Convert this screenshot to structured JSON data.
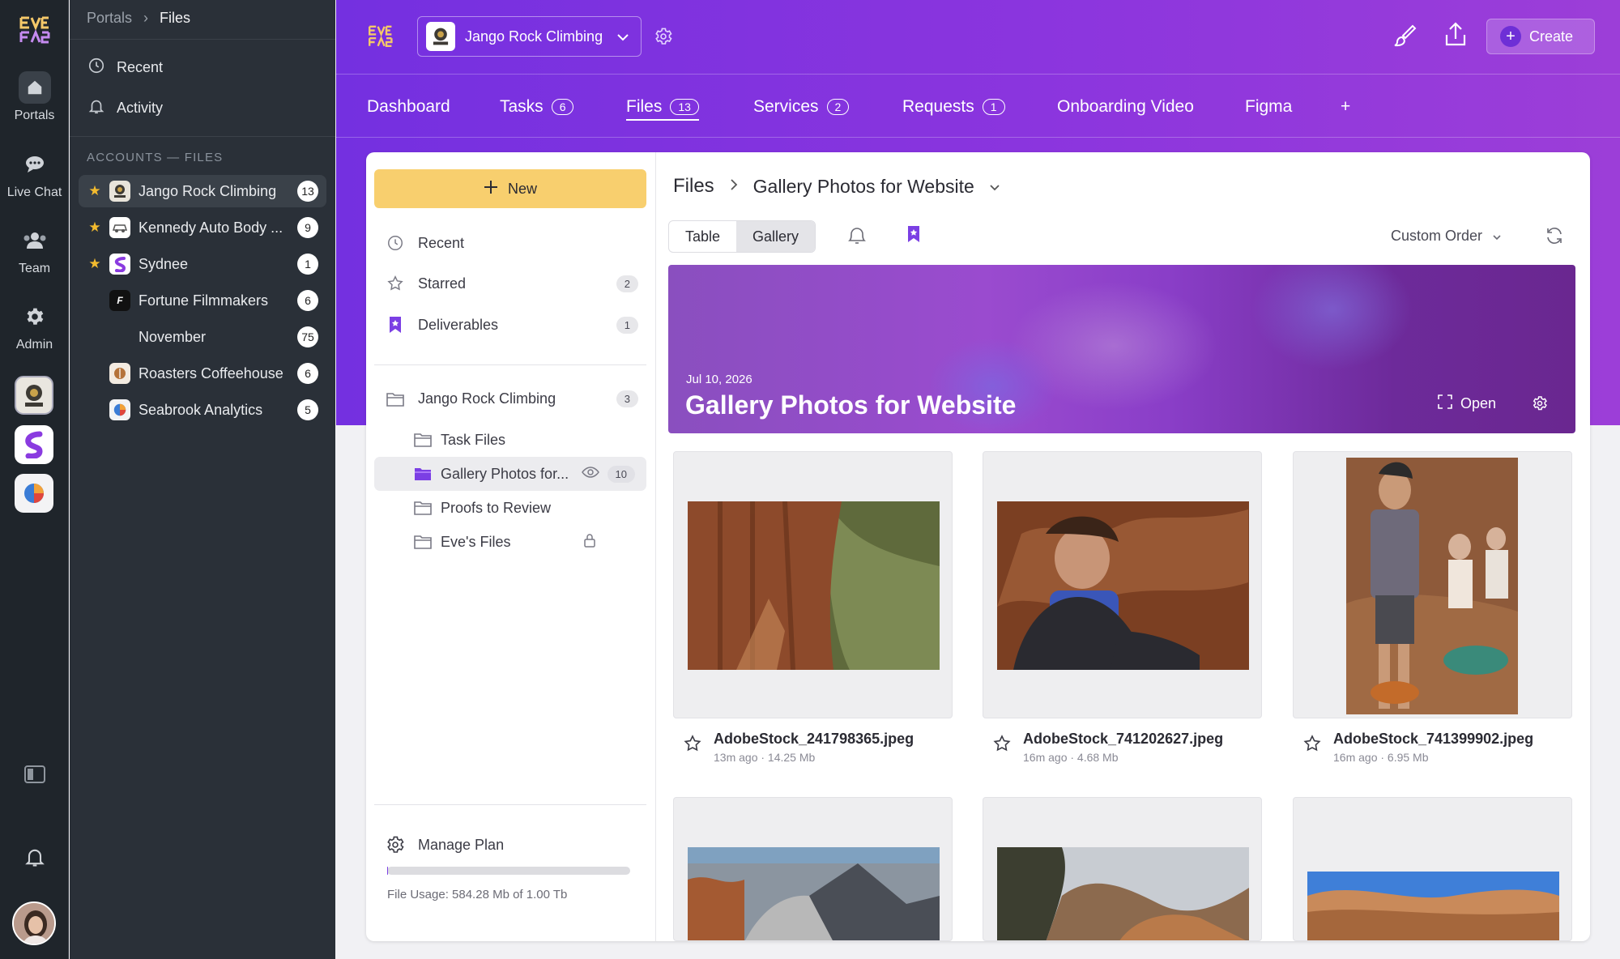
{
  "rail": {
    "items": [
      {
        "label": "Portals",
        "icon": "home-icon"
      },
      {
        "label": "Live Chat",
        "icon": "chat-icon"
      },
      {
        "label": "Team",
        "icon": "team-icon"
      },
      {
        "label": "Admin",
        "icon": "gear-icon"
      }
    ]
  },
  "nav": {
    "breadcrumb": [
      "Portals",
      "Files"
    ],
    "recent": "Recent",
    "activity": "Activity",
    "section_heading": "ACCOUNTS — FILES",
    "accounts": [
      {
        "name": "Jango Rock Climbing",
        "count": "13",
        "starred": true
      },
      {
        "name": "Kennedy Auto Body ...",
        "count": "9",
        "starred": true
      },
      {
        "name": "Sydnee",
        "count": "1",
        "starred": true
      },
      {
        "name": "Fortune Filmmakers",
        "count": "6",
        "starred": false
      },
      {
        "name": "November",
        "count": "75",
        "starred": false
      },
      {
        "name": "Roasters Coffeehouse",
        "count": "6",
        "starred": false
      },
      {
        "name": "Seabrook Analytics",
        "count": "5",
        "starred": false
      }
    ]
  },
  "header": {
    "workspace": "Jango Rock Climbing",
    "create_label": "Create",
    "tabs": [
      {
        "label": "Dashboard",
        "badge": ""
      },
      {
        "label": "Tasks",
        "badge": "6"
      },
      {
        "label": "Files",
        "badge": "13"
      },
      {
        "label": "Services",
        "badge": "2"
      },
      {
        "label": "Requests",
        "badge": "1"
      },
      {
        "label": "Onboarding Video",
        "badge": ""
      },
      {
        "label": "Figma",
        "badge": ""
      },
      {
        "label": "+",
        "badge": ""
      }
    ]
  },
  "files_nav": {
    "new_label": "New",
    "recent": "Recent",
    "starred": "Starred",
    "starred_count": "2",
    "deliverables": "Deliverables",
    "deliverables_count": "1",
    "root_folder": "Jango Rock Climbing",
    "root_count": "3",
    "folders": [
      {
        "name": "Task Files"
      },
      {
        "name": "Gallery Photos for...",
        "count": "10"
      },
      {
        "name": "Proofs to Review"
      },
      {
        "name": "Eve's Files"
      }
    ],
    "manage_plan": "Manage Plan",
    "usage_text": "File Usage: 584.28 Mb of 1.00 Tb",
    "usage_fraction": 0.0006
  },
  "content": {
    "path_root": "Files",
    "path_current": "Gallery Photos for Website",
    "view_table": "Table",
    "view_gallery": "Gallery",
    "sort": "Custom Order",
    "banner_date": "Jul 10, 2026",
    "banner_title": "Gallery Photos for Website",
    "banner_open": "Open",
    "files": [
      {
        "name": "AdobeStock_241798365.jpeg",
        "meta": "13m ago · 14.25 Mb"
      },
      {
        "name": "AdobeStock_741202627.jpeg",
        "meta": "16m ago · 4.68 Mb"
      },
      {
        "name": "AdobeStock_741399902.jpeg",
        "meta": "16m ago · 6.95 Mb"
      }
    ]
  }
}
